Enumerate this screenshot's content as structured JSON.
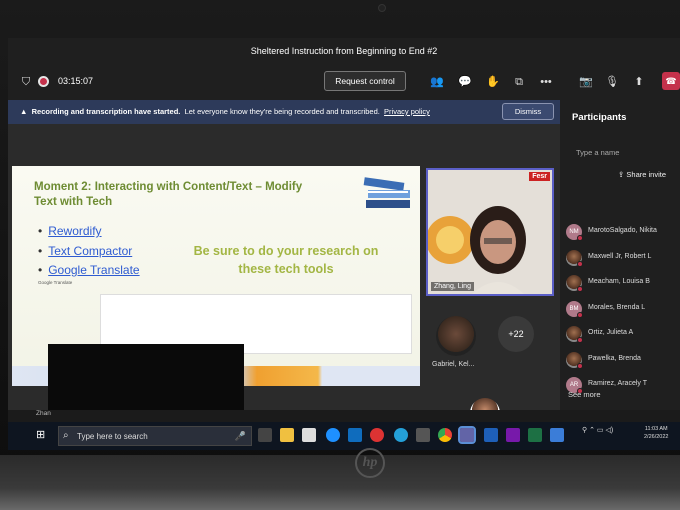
{
  "window": {
    "title": "Sheltered Instruction from Beginning to End #2"
  },
  "toolbar": {
    "timer": "03:15:07",
    "request_control": "Request control",
    "icons": [
      "shield-icon",
      "record-icon",
      "people-icon",
      "chat-icon",
      "raise-hand-icon",
      "share-tray-icon",
      "more-icon",
      "camera-icon",
      "mic-off-icon",
      "share-screen-icon",
      "leave-icon"
    ]
  },
  "notice": {
    "bold": "Recording and transcription have started.",
    "text": "Let everyone know they're being recorded and transcribed.",
    "link": "Privacy policy",
    "dismiss": "Dismiss"
  },
  "slide": {
    "title": "Moment 2: Interacting with Content/Text – Modify Text with Tech",
    "bullets": [
      "Rewordify",
      "Text Compactor",
      "Google Translate"
    ],
    "tip": "Be sure to do your research on these tech tools",
    "caption": "Google Translate"
  },
  "tiles": {
    "presenter_name": "Zhang, Ling",
    "badge": "Fesr",
    "gabriel_name": "Gabriel, Kel...",
    "overflow": "+22"
  },
  "participants": {
    "title": "Participants",
    "search_placeholder": "Type a name",
    "share_invite": "Share invite",
    "list": [
      {
        "initials": "NM",
        "name": "MarotoSalgado, Nikita",
        "photo": false
      },
      {
        "initials": "",
        "name": "Maxwell Jr, Robert L",
        "photo": true
      },
      {
        "initials": "",
        "name": "Meacham, Louisa B",
        "photo": true
      },
      {
        "initials": "BM",
        "name": "Morales, Brenda L",
        "photo": false
      },
      {
        "initials": "",
        "name": "Ortiz, Julieta A",
        "photo": true
      },
      {
        "initials": "",
        "name": "Pawelka, Brenda",
        "photo": true
      },
      {
        "initials": "AR",
        "name": "Ramirez, Aracely T",
        "photo": false
      }
    ],
    "see_more": "See more"
  },
  "strip": {
    "truncated_name": "Zhan"
  },
  "taskbar": {
    "search_placeholder": "Type here to search",
    "clock_time": "11:03 AM",
    "clock_date": "2/26/2022"
  },
  "device": {
    "brand": "hp"
  }
}
